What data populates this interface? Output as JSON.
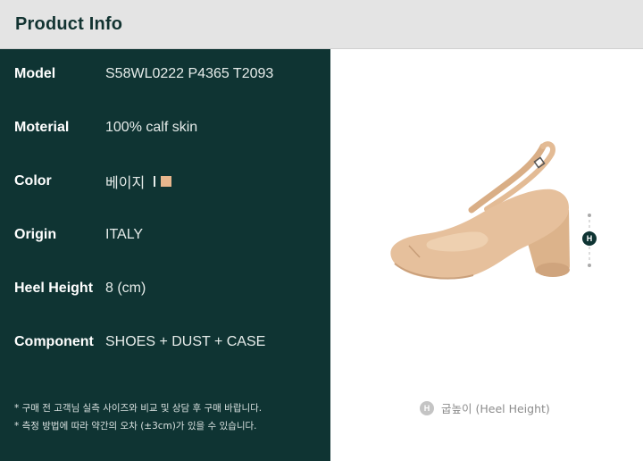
{
  "header": {
    "title": "Product Info"
  },
  "specs": [
    {
      "label": "Model",
      "value": "S58WL0222 P4365 T2093"
    },
    {
      "label": "Moterial",
      "value": "100% calf skin"
    },
    {
      "label": "Color",
      "value": "베이지"
    },
    {
      "label": "Origin",
      "value": "ITALY"
    },
    {
      "label": "Heel Height",
      "value": "8 (cm)"
    },
    {
      "label": "Component",
      "value": "SHOES + DUST + CASE"
    }
  ],
  "color_swatch": "#e7b68d",
  "notes": [
    "* 구매 전 고객님 실측 사이즈와 비교 및 상담 후 구매 바랍니다.",
    "* 측정 방법에 따라 약간의 오차 (±3cm)가 있을 수 있습니다."
  ],
  "marker": {
    "letter": "H"
  },
  "caption": {
    "badge": "H",
    "text": "굽높이 (Heel Height)"
  },
  "colors": {
    "panel": "#0f3433",
    "header_bg": "#e4e4e4",
    "shoe": "#e8c39f"
  }
}
